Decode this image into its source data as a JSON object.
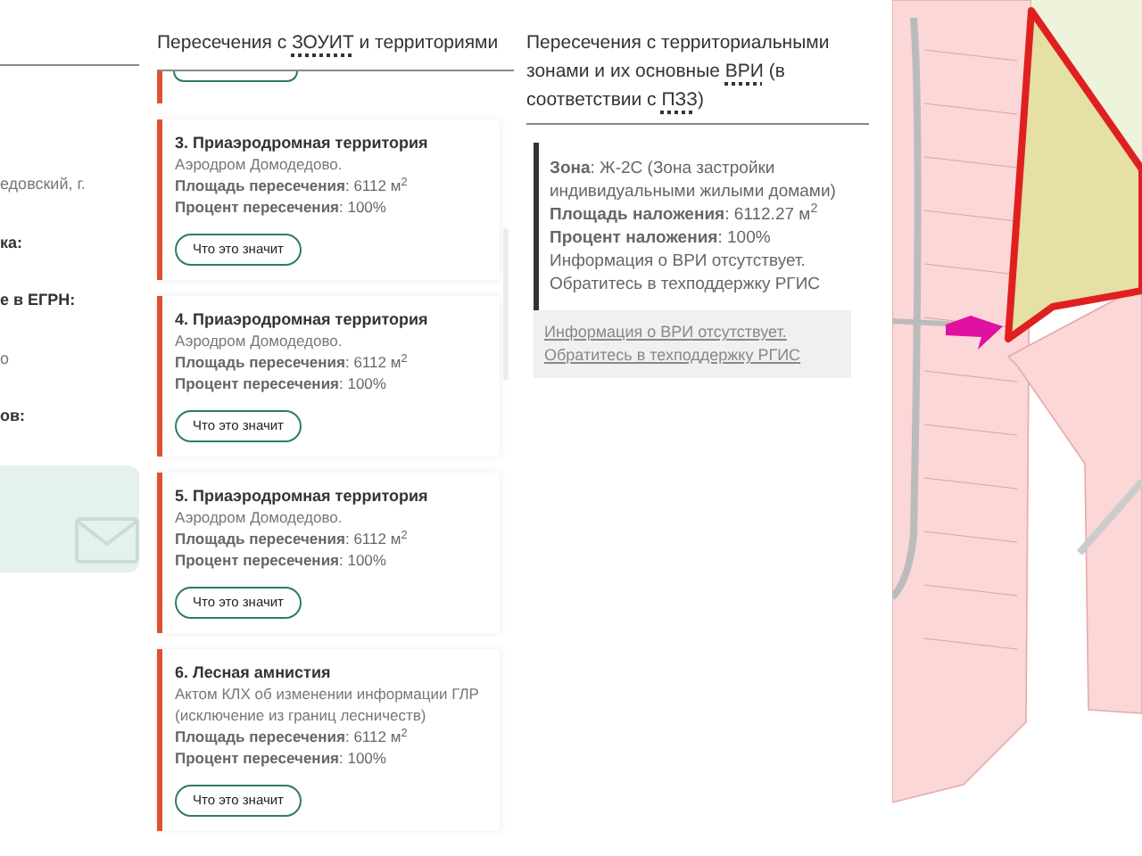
{
  "left_panel": {
    "fragments": [
      {
        "text": "едовский, г.",
        "bold": false
      },
      {
        "text": "ка:",
        "bold": true
      },
      {
        "text": "е в ЕГРН:",
        "bold": true
      },
      {
        "text": "о",
        "bold": false
      },
      {
        "text": "ов:",
        "bold": true
      }
    ]
  },
  "zouit": {
    "title": [
      {
        "text": "Пересечения с ",
        "abbr": false
      },
      {
        "text": "ЗОУИТ",
        "abbr": true
      },
      {
        "text": " и территориями",
        "abbr": false
      }
    ],
    "items": [
      {
        "title": "3. Приаэродромная территория",
        "description": "Аэродром Домодедово.",
        "area": "**Площадь пересечения**: 6112 м$^{2}$",
        "percent": "**Процент пересечения**: 100%",
        "button": "Что это значит"
      },
      {
        "title": "4. Приаэродромная территория",
        "description": "Аэродром Домодедово.",
        "area": "**Площадь пересечения**: 6112 м$^{2}$",
        "percent": "**Процент пересечения**: 100%",
        "button": "Что это значит"
      },
      {
        "title": "5. Приаэродромная территория",
        "description": "Аэродром Домодедово.",
        "area": "**Площадь пересечения**: 6112 м$^{2}$",
        "percent": "**Процент пересечения**: 100%",
        "button": "Что это значит"
      },
      {
        "title": "6. Лесная амнистия",
        "description": "Актом КЛХ об изменении информации ГЛР (исключение из границ лесничеств)",
        "area": "**Площадь пересечения**: 6112 м$^{2}$",
        "percent": "**Процент пересечения**: 100%",
        "button": "Что это значит"
      }
    ]
  },
  "zones": {
    "title": [
      {
        "text": "Пересечения с территориальными зонами и их основные ",
        "abbr": false
      },
      {
        "text": "ВРИ",
        "abbr": true
      },
      {
        "text": " (в соответствии с ",
        "abbr": false
      },
      {
        "text": "ПЗЗ",
        "abbr": true
      },
      {
        "text": ")",
        "abbr": false
      }
    ],
    "zone": "**Зона**: Ж-2С (Зона застройки индивидуальными жилыми домами)",
    "area": "**Площадь наложения**: 6112.27 м$^{2}$",
    "percent": "**Процент наложения**: 100%",
    "note": "Информация о ВРИ отсутствует. Обратитесь в техподдержку РГИС",
    "link": "Информация о ВРИ отсутствует. Обратитесь в техподдержку РГИС"
  }
}
